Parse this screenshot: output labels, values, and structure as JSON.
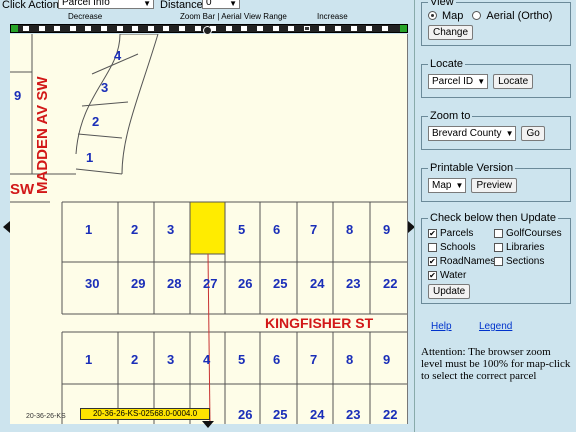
{
  "toolbar": {
    "click_action_label": "Click Action:",
    "click_action_value": "Parcel Info",
    "distance_label": "Distance",
    "distance_value": "0"
  },
  "zoombar": {
    "decrease_label": "Decrease",
    "center_label": "Zoom Bar | Aerial View Range",
    "increase_label": "Increase",
    "steps": 24,
    "active_step": 18
  },
  "map": {
    "streets": [
      "MADDEN AV SW",
      "SW",
      "KINGFISHER ST"
    ],
    "curved_lots": [
      "4",
      "3",
      "2",
      "1"
    ],
    "left_lot": "9",
    "row_a": [
      "1",
      "2",
      "3",
      "",
      "5",
      "6",
      "7",
      "8",
      "9"
    ],
    "row_b": [
      "30",
      "29",
      "28",
      "27",
      "26",
      "25",
      "24",
      "23",
      "22"
    ],
    "row_c": [
      "1",
      "2",
      "3",
      "4",
      "5",
      "6",
      "7",
      "8",
      "9"
    ],
    "row_d": [
      "26",
      "25",
      "24",
      "23",
      "22"
    ],
    "selected_parcel_id": "20-36-26-KS-02568.0-0004.0",
    "scale_text": "20-36-26-KS",
    "highlight_color": "#ffec00",
    "lot_number_color": "#1a2eb8",
    "street_color": "#d21818"
  },
  "panel": {
    "view": {
      "legend": "View",
      "options": [
        "Map",
        "Aerial (Ortho)"
      ],
      "selected": "Map",
      "button": "Change"
    },
    "locate": {
      "legend": "Locate",
      "select_value": "Parcel ID",
      "button": "Locate"
    },
    "zoom_to": {
      "legend": "Zoom to",
      "select_value": "Brevard County",
      "button": "Go"
    },
    "printable": {
      "legend": "Printable Version",
      "select_value": "Map",
      "button": "Preview"
    },
    "layers": {
      "legend": "Check below then Update",
      "items": [
        {
          "label": "Parcels",
          "checked": true
        },
        {
          "label": "GolfCourses",
          "checked": false
        },
        {
          "label": "Schools",
          "checked": false
        },
        {
          "label": "Libraries",
          "checked": false
        },
        {
          "label": "RoadNames",
          "checked": true
        },
        {
          "label": "Sections",
          "checked": false
        },
        {
          "label": "Water",
          "checked": true
        }
      ],
      "button": "Update"
    },
    "help_link": "Help",
    "legend_link": "Legend",
    "note": "Attention: The browser zoom level must be 100% for map-click to select the correct parcel"
  }
}
